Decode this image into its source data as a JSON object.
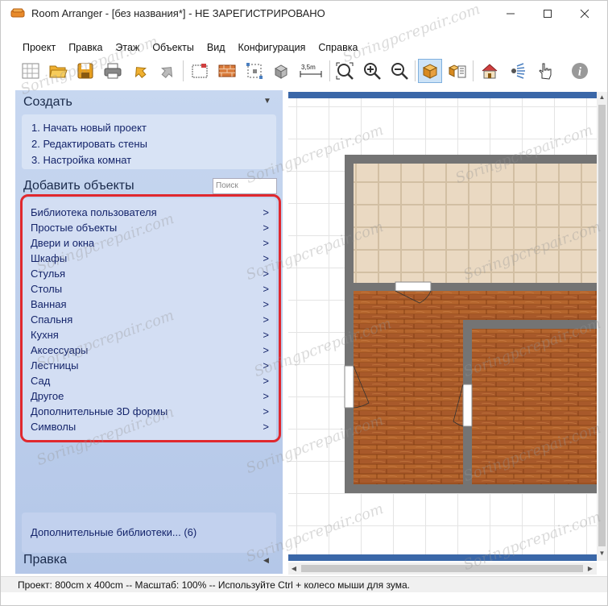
{
  "window": {
    "title": "Room Arranger - [без названия*] - НЕ ЗАРЕГИСТРИРОВАНО"
  },
  "menu": [
    "Проект",
    "Правка",
    "Этаж",
    "Объекты",
    "Вид",
    "Конфигурация",
    "Справка"
  ],
  "toolbar": {
    "scale_label": "3,5m"
  },
  "sidebar": {
    "create_title": "Создать",
    "steps": [
      "1. Начать новый проект",
      "2. Редактировать стены",
      "3. Настройка комнат"
    ],
    "add_title": "Добавить объекты",
    "search_placeholder": "Поиск",
    "categories": [
      "Библиотека пользователя",
      "Простые объекты",
      "Двери и окна",
      "Шкафы",
      "Стулья",
      "Столы",
      "Ванная",
      "Спальня",
      "Кухня",
      "Аксессуары",
      "Лестницы",
      "Сад",
      "Другое",
      "Дополнительные 3D формы",
      "Символы"
    ],
    "arrow": ">",
    "extra_libraries": "Дополнительные библиотеки... (6)",
    "edit_title": "Правка"
  },
  "status": {
    "text": "Проект: 800cm x 400cm -- Масштаб: 100% -- Используйте Ctrl + колесо мыши для зума."
  },
  "watermark": "Soringpcrepair.com",
  "colors": {
    "panel_bg": "#c7d7f0",
    "link_text": "#14246a",
    "highlight": "#e0282e",
    "wall": "#707070",
    "wood": "#b5652d",
    "tile": "#ead9c2"
  }
}
